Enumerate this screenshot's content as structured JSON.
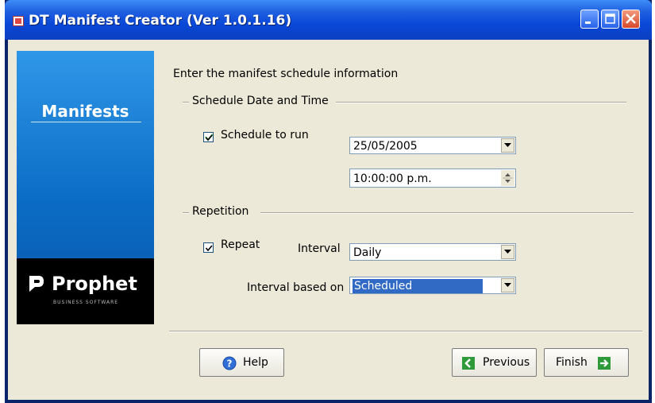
{
  "window": {
    "title": "DT Manifest Creator (Ver 1.0.1.16)"
  },
  "sidebar": {
    "heading": "Manifests",
    "brand_name": "Prophet",
    "brand_sub": "BUSINESS SOFTWARE"
  },
  "main": {
    "instruction": "Enter the manifest schedule information",
    "schedule_group": {
      "title": "Schedule Date and Time",
      "schedule_to_run_label": "Schedule to run",
      "schedule_to_run_checked": true,
      "date_value": "25/05/2005",
      "time_value": "10:00:00 p.m."
    },
    "repetition_group": {
      "title": "Repetition",
      "repeat_label": "Repeat",
      "repeat_checked": true,
      "interval_label": "Interval",
      "interval_value": "Daily",
      "interval_based_on_label": "Interval based on",
      "interval_based_on_value": "Scheduled"
    }
  },
  "footer": {
    "help_label": "Help",
    "previous_label": "Previous",
    "finish_label": "Finish"
  },
  "colors": {
    "title_bar": "#0a48d8",
    "dialog_bg": "#ece9d8",
    "side_panel": "#0b6cc5",
    "selection": "#316ac5"
  }
}
